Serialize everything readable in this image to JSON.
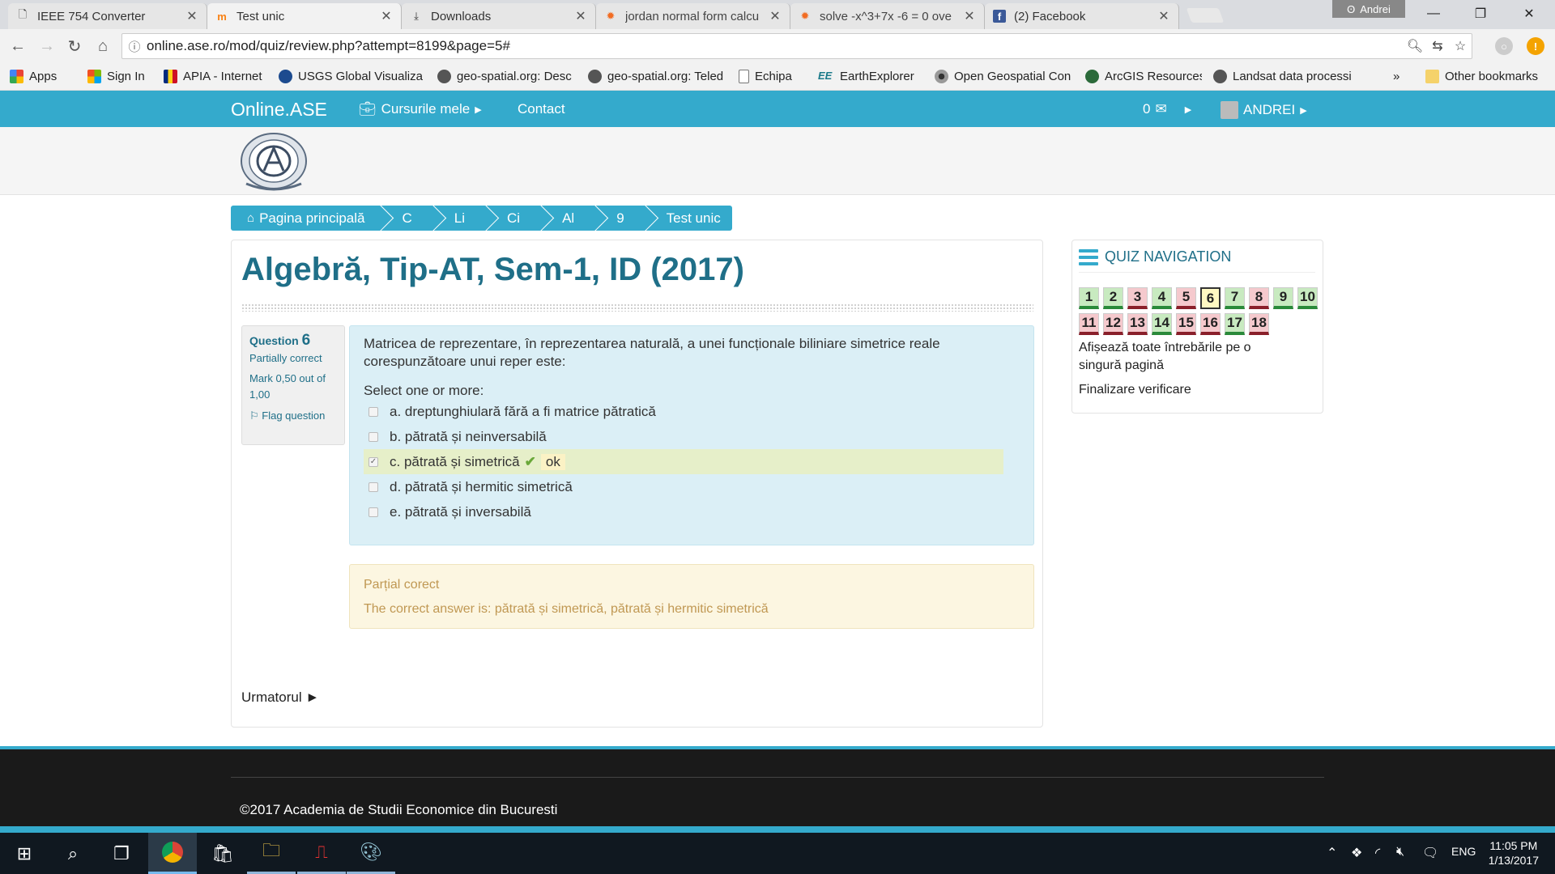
{
  "browser": {
    "tabs": [
      {
        "label": "IEEE 754 Converter",
        "icon": "page-icon"
      },
      {
        "label": "Test unic",
        "icon": "moodle-icon",
        "active": true
      },
      {
        "label": "Downloads",
        "icon": "download-icon"
      },
      {
        "label": "jordan normal form calcu",
        "icon": "wolfram-icon"
      },
      {
        "label": "solve -x^3+7x -6 = 0 ove",
        "icon": "wolfram-icon"
      },
      {
        "label": "(2) Facebook",
        "icon": "facebook-icon"
      }
    ],
    "profile": "Andrei",
    "url": "online.ase.ro/mod/quiz/review.php?attempt=8199&page=5#",
    "bookmarks": [
      {
        "label": "Apps"
      },
      {
        "label": "Sign In"
      },
      {
        "label": "APIA - Internet"
      },
      {
        "label": "USGS Global Visualiza"
      },
      {
        "label": "geo-spatial.org: Desc"
      },
      {
        "label": "geo-spatial.org: Teled"
      },
      {
        "label": "Echipa"
      },
      {
        "label": "EarthExplorer"
      },
      {
        "label": "Open Geospatial Con"
      },
      {
        "label": "ArcGIS Resources"
      },
      {
        "label": "Landsat data processi"
      }
    ],
    "bookmarks_more": "»",
    "other_bookmarks": "Other bookmarks"
  },
  "site": {
    "brand": "Online.ASE",
    "courses": "Cursurile mele",
    "contact": "Contact",
    "messages": "0",
    "user": "ANDREI"
  },
  "breadcrumb": [
    "Pagina principală",
    "C",
    "Li",
    "Ci",
    "Al",
    "9",
    "Test unic"
  ],
  "page": {
    "title": "Algebră, Tip-AT, Sem-1, ID (2017)",
    "next": "Urmatorul ►"
  },
  "question": {
    "label": "Question",
    "number": "6",
    "state": "Partially correct",
    "mark": "Mark 0,50 out of 1,00",
    "flag": "Flag question",
    "text": "Matricea de reprezentare, în reprezentarea naturală, a unei funcționale biliniare simetrice reale corespunzătoare unui reper este:",
    "prompt": "Select one or more:",
    "options": [
      {
        "text": "a. dreptunghiulară fără a fi matrice pătratică",
        "checked": false
      },
      {
        "text": "b. pătrată și neinversabilă",
        "checked": false
      },
      {
        "text": "c. pătrată și simetrică",
        "checked": true,
        "feedback": "ok"
      },
      {
        "text": "d. pătrată și hermitic simetrică",
        "checked": false
      },
      {
        "text": "e. pătrată și inversabilă",
        "checked": false
      }
    ],
    "feedback_title": "Parțial corect",
    "correct_answer": "The correct answer is: pătrată și simetrică, pătrată și hermitic simetrică"
  },
  "quiz_nav": {
    "title": "QUIZ NAVIGATION",
    "buttons": [
      {
        "n": "1",
        "s": "c"
      },
      {
        "n": "2",
        "s": "c"
      },
      {
        "n": "3",
        "s": "w"
      },
      {
        "n": "4",
        "s": "c"
      },
      {
        "n": "5",
        "s": "w"
      },
      {
        "n": "6",
        "s": "cur"
      },
      {
        "n": "7",
        "s": "c"
      },
      {
        "n": "8",
        "s": "w"
      },
      {
        "n": "9",
        "s": "c"
      },
      {
        "n": "10",
        "s": "c"
      },
      {
        "n": "11",
        "s": "w"
      },
      {
        "n": "12",
        "s": "w"
      },
      {
        "n": "13",
        "s": "w"
      },
      {
        "n": "14",
        "s": "c"
      },
      {
        "n": "15",
        "s": "w"
      },
      {
        "n": "16",
        "s": "w"
      },
      {
        "n": "17",
        "s": "c"
      },
      {
        "n": "18",
        "s": "w"
      }
    ],
    "show_all": "Afișează toate întrebările pe o singură pagină",
    "finish": "Finalizare verificare"
  },
  "footer": {
    "copyright": "©2017 Academia de Studii Economice din Bucuresti"
  },
  "taskbar": {
    "lang": "ENG",
    "time": "11:05 PM",
    "date": "1/13/2017"
  }
}
